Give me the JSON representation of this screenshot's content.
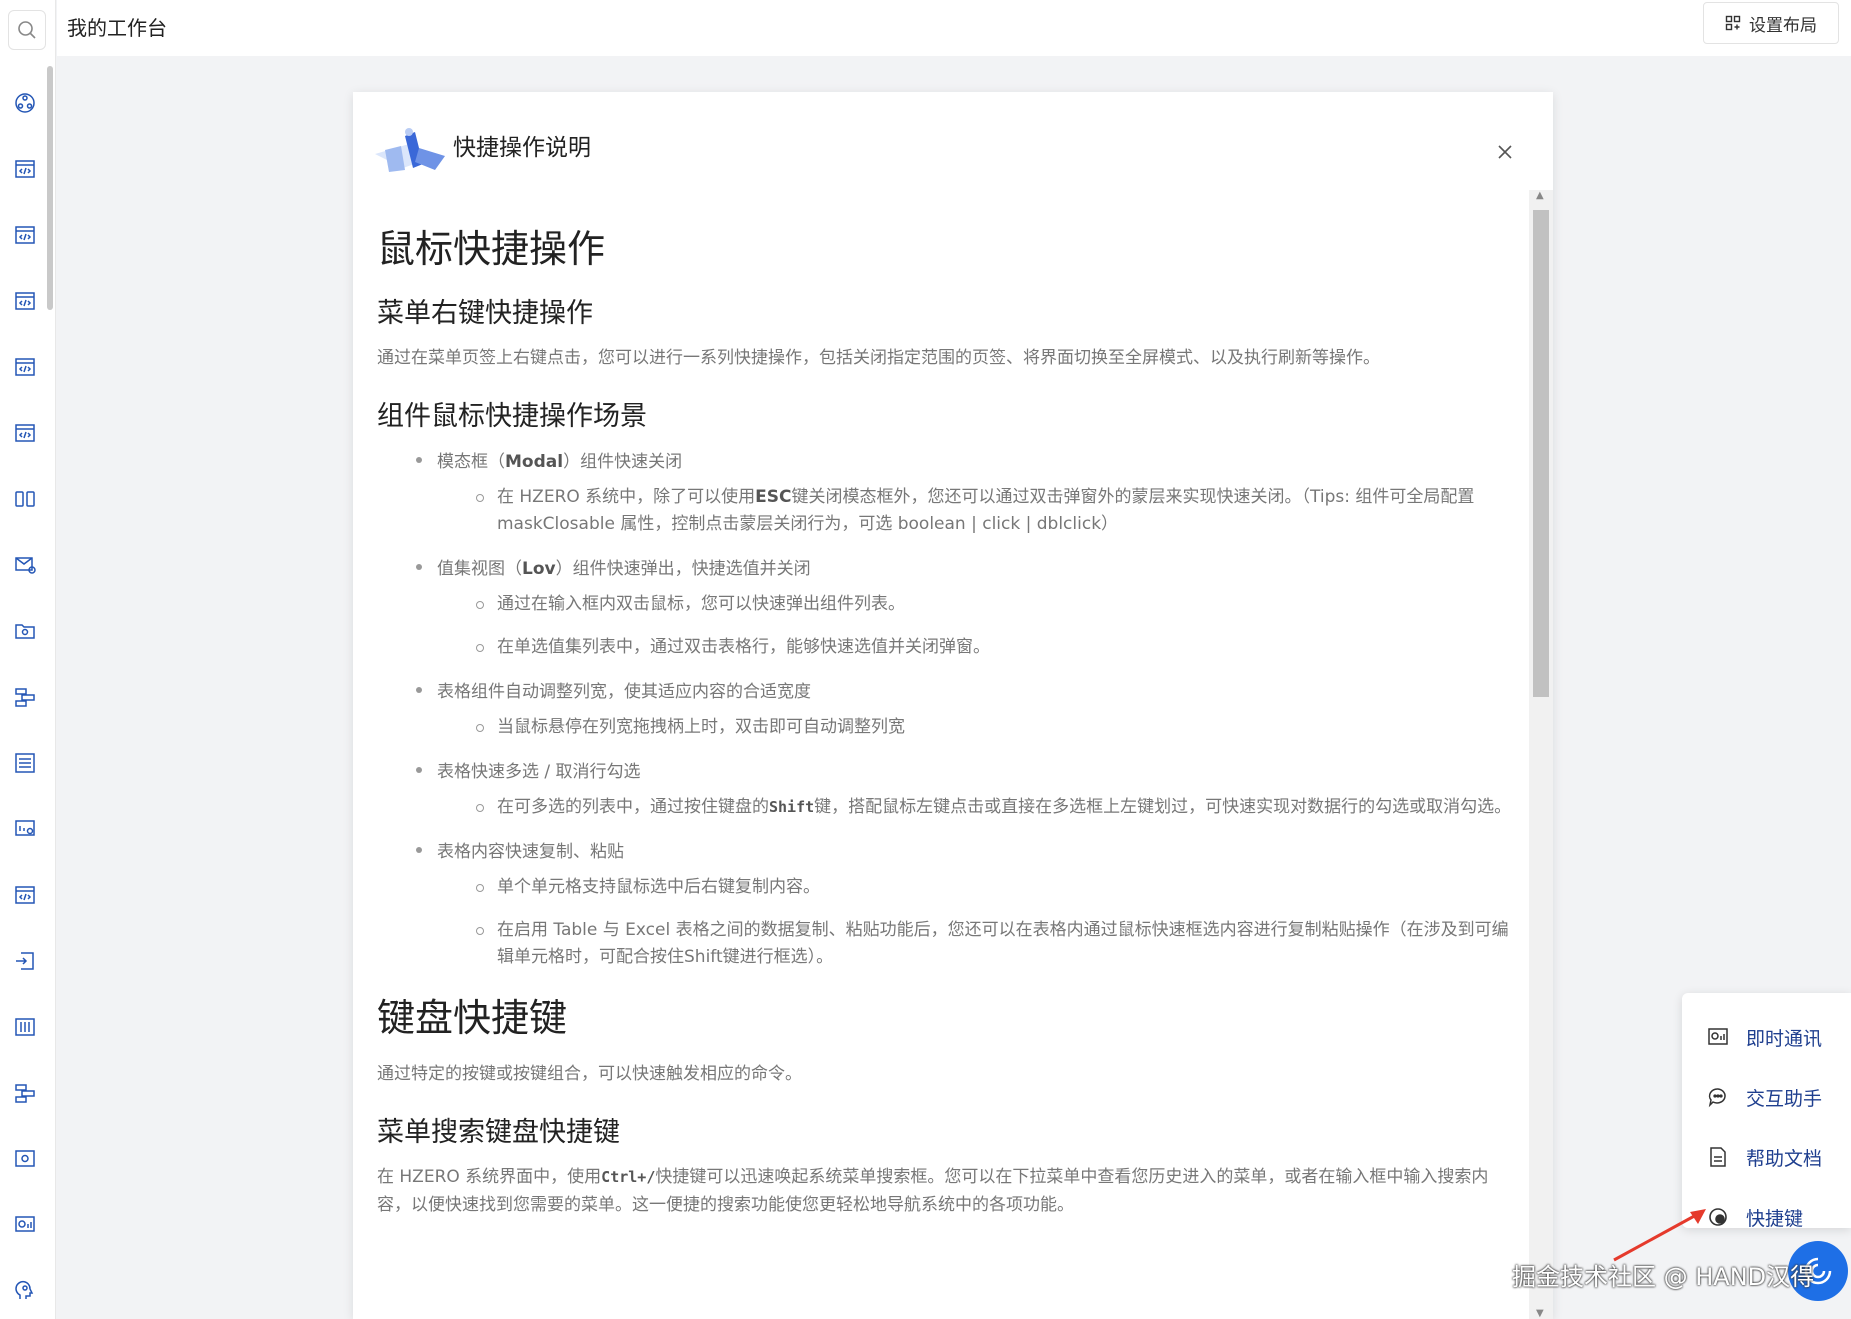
{
  "header": {
    "title": "我的工作台",
    "layout_button": "设置布局"
  },
  "sidebar": {
    "icons": [
      "search-icon",
      "gear-cluster-icon",
      "code-window-icon",
      "code-window-icon",
      "code-window-icon",
      "code-window-icon",
      "code-window-icon",
      "split-panel-icon",
      "mail-settings-icon",
      "folder-settings-icon",
      "flow-icon",
      "list-settings-icon",
      "chart-settings-icon",
      "code-window-icon",
      "import-icon",
      "equalizer-icon",
      "flow-icon",
      "window-settings-icon",
      "monitor-chart-icon",
      "brain-icon"
    ]
  },
  "modal": {
    "title": "快捷操作说明",
    "h1_mouse": "鼠标快捷操作",
    "h2_menu": "菜单右键快捷操作",
    "p_menu": "通过在菜单页签上右键点击，您可以进行一系列快捷操作，包括关闭指定范围的页签、将界面切换至全屏模式、以及执行刷新等操作。",
    "h2_component": "组件鼠标快捷操作场景",
    "modal_item": {
      "pre": "模态框（",
      "bold": "Modal",
      "post": "）组件快速关闭",
      "sub": {
        "pre": "在 HZERO 系统中，除了可以使用",
        "bold": "ESC",
        "post": "键关闭模态框外，您还可以通过双击弹窗外的蒙层来实现快速关闭。（Tips: 组件可全局配置 maskClosable 属性，控制点击蒙层关闭行为，可选 boolean | click | dblclick）"
      }
    },
    "lov_item": {
      "pre": "值集视图（",
      "bold": "Lov",
      "post": "）组件快速弹出，快捷选值并关闭",
      "sub1": "通过在输入框内双击鼠标，您可以快速弹出组件列表。",
      "sub2": "在单选值集列表中，通过双击表格行，能够快速选值并关闭弹窗。"
    },
    "col_item": {
      "text": "表格组件自动调整列宽，使其适应内容的合适宽度",
      "sub": "当鼠标悬停在列宽拖拽柄上时，双击即可自动调整列宽"
    },
    "multi_item": {
      "text": "表格快速多选 / 取消行勾选",
      "sub_pre": "在可多选的列表中，通过按住键盘的",
      "sub_code": "Shift",
      "sub_post": "键，搭配鼠标左键点击或直接在多选框上左键划过，可快速实现对数据行的勾选或取消勾选。"
    },
    "copy_item": {
      "text": "表格内容快速复制、粘贴",
      "sub1": "单个单元格支持鼠标选中后右键复制内容。",
      "sub2": "在启用 Table 与 Excel 表格之间的数据复制、粘贴功能后，您还可以在表格内通过鼠标快速框选内容进行复制粘贴操作（在涉及到可编辑单元格时，可配合按住Shift键进行框选）。"
    },
    "h1_keyboard": "键盘快捷键",
    "p_keyboard": "通过特定的按键或按键组合，可以快速触发相应的命令。",
    "h2_search": "菜单搜索键盘快捷键",
    "p_search_pre": "在 HZERO 系统界面中，使用",
    "p_search_code": "Ctrl+/",
    "p_search_post": "快捷键可以迅速唤起系统菜单搜索框。您可以在下拉菜单中查看您历史进入的菜单，或者在输入框中输入搜索内容，以便快速找到您需要的菜单。这一便捷的搜索功能使您更轻松地导航系统中的各项功能。"
  },
  "help_panel": {
    "items": [
      {
        "label": "即时通讯",
        "icon": "chat-window-icon"
      },
      {
        "label": "交互助手",
        "icon": "speech-bubble-icon"
      },
      {
        "label": "帮助文档",
        "icon": "document-icon"
      },
      {
        "label": "快捷键",
        "icon": "shortcut-icon"
      }
    ]
  },
  "watermark": "掘金技术社区 @ HAND汉得",
  "colors": {
    "accent": "#1e6fe6",
    "icon_blue": "#2456b5",
    "help_text": "#1f3f8f"
  }
}
